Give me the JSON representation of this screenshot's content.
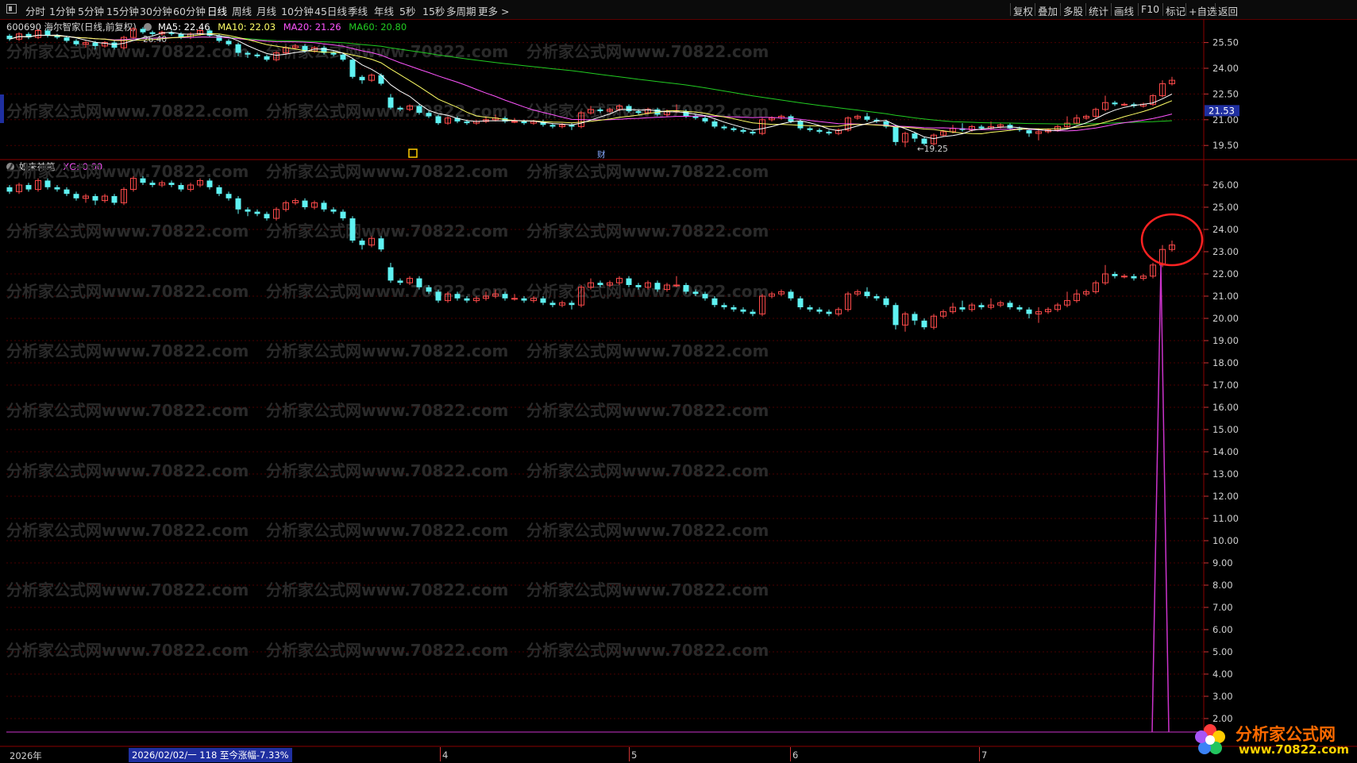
{
  "toolbar": {
    "periods": [
      "分时",
      "1分钟",
      "5分钟",
      "15分钟",
      "30分钟",
      "60分钟",
      "日线",
      "周线",
      "月线",
      "10分钟",
      "45日线",
      "季线",
      "年线",
      "5秒",
      "15秒",
      "多周期",
      "更多 >"
    ],
    "active_period": "日线",
    "tools": [
      "复权",
      "叠加",
      "多股",
      "统计",
      "画线",
      "F10",
      "标记",
      "+自选",
      "返回"
    ]
  },
  "main_info": {
    "title": "600690 海尔智家(日线,前复权)",
    "ma5": "MA5: 22.46",
    "ma10": "MA10: 22.03",
    "ma20": "MA20: 21.26",
    "ma60": "MA60: 20.80",
    "colors": {
      "ma5": "#ffffff",
      "ma10": "#ffff66",
      "ma20": "#ff55ff",
      "ma60": "#22cc22"
    }
  },
  "indicator_info": {
    "name": "如来神笔",
    "value": "XG: 0.00"
  },
  "price_axis_main": [
    "25.50",
    "24.00",
    "22.50",
    "21.00",
    "19.50"
  ],
  "current_price_tag": "21.53",
  "price_axis_sub": [
    "26.00",
    "25.00",
    "24.00",
    "23.00",
    "22.00",
    "21.00",
    "20.00",
    "19.00",
    "18.00",
    "17.00",
    "16.00",
    "15.00",
    "14.00",
    "13.00",
    "12.00",
    "11.00",
    "10.00",
    "9.00",
    "8.00",
    "7.00",
    "6.00",
    "5.00",
    "4.00",
    "3.00",
    "2.00"
  ],
  "annotations": {
    "high_label": "26.40",
    "low_label": "←19.25",
    "event_marker_1": "回",
    "event_marker_2": "财"
  },
  "watermark": "分析家公式网www.70822.com",
  "x_axis": {
    "year": "2026年",
    "cursor_info": "2026/02/02/一 118 至今涨幅-7.33%",
    "months": [
      "4",
      "5",
      "6",
      "7"
    ]
  },
  "logo": {
    "cn": "分析家公式网",
    "url": "www.70822.com"
  },
  "chart_data": {
    "type": "candlestick",
    "up_color": "#ff4a4a",
    "down_color": "#5ff2f2",
    "x_axis_note": "daily bars, 2026",
    "candles": [
      [
        25.9,
        25.7,
        26.0,
        25.6
      ],
      [
        25.7,
        26.0,
        26.1,
        25.6
      ],
      [
        26.0,
        25.8,
        26.1,
        25.7
      ],
      [
        25.8,
        26.2,
        26.3,
        25.7
      ],
      [
        26.2,
        25.9,
        26.3,
        25.8
      ],
      [
        25.9,
        25.8,
        26.0,
        25.7
      ],
      [
        25.8,
        25.6,
        25.9,
        25.5
      ],
      [
        25.6,
        25.4,
        25.7,
        25.3
      ],
      [
        25.4,
        25.5,
        25.6,
        25.2
      ],
      [
        25.5,
        25.3,
        25.6,
        25.1
      ],
      [
        25.3,
        25.5,
        25.6,
        25.2
      ],
      [
        25.5,
        25.2,
        25.6,
        25.1
      ],
      [
        25.2,
        25.8,
        25.9,
        25.1
      ],
      [
        25.8,
        26.3,
        26.4,
        25.7
      ],
      [
        26.3,
        26.1,
        26.4,
        26.0
      ],
      [
        26.1,
        26.0,
        26.2,
        25.9
      ],
      [
        26.0,
        26.1,
        26.2,
        25.9
      ],
      [
        26.1,
        26.0,
        26.2,
        25.9
      ],
      [
        26.0,
        25.8,
        26.1,
        25.7
      ],
      [
        25.8,
        26.0,
        26.1,
        25.7
      ],
      [
        26.0,
        26.2,
        26.3,
        25.9
      ],
      [
        26.2,
        25.9,
        26.3,
        25.8
      ],
      [
        25.9,
        25.6,
        26.0,
        25.5
      ],
      [
        25.6,
        25.4,
        25.7,
        25.3
      ],
      [
        25.4,
        24.9,
        25.5,
        24.7
      ],
      [
        24.9,
        24.8,
        25.0,
        24.6
      ],
      [
        24.8,
        24.7,
        24.9,
        24.6
      ],
      [
        24.7,
        24.5,
        24.8,
        24.4
      ],
      [
        24.5,
        24.9,
        25.0,
        24.4
      ],
      [
        24.9,
        25.2,
        25.3,
        24.8
      ],
      [
        25.2,
        25.3,
        25.4,
        25.1
      ],
      [
        25.3,
        25.0,
        25.4,
        24.9
      ],
      [
        25.0,
        25.2,
        25.3,
        24.9
      ],
      [
        25.2,
        24.9,
        25.3,
        24.8
      ],
      [
        24.9,
        24.8,
        25.0,
        24.7
      ],
      [
        24.8,
        24.5,
        24.9,
        24.4
      ],
      [
        24.5,
        23.5,
        24.6,
        23.4
      ],
      [
        23.5,
        23.3,
        23.6,
        23.1
      ],
      [
        23.3,
        23.6,
        23.7,
        23.2
      ],
      [
        23.6,
        23.1,
        23.7,
        23.0
      ],
      [
        22.3,
        21.7,
        22.5,
        21.6
      ],
      [
        21.7,
        21.6,
        21.8,
        21.5
      ],
      [
        21.6,
        21.8,
        21.9,
        21.5
      ],
      [
        21.8,
        21.4,
        21.9,
        21.3
      ],
      [
        21.4,
        21.2,
        21.5,
        21.1
      ],
      [
        21.2,
        20.8,
        21.3,
        20.7
      ],
      [
        20.8,
        21.1,
        21.2,
        20.7
      ],
      [
        21.1,
        20.9,
        21.2,
        20.8
      ],
      [
        20.9,
        20.8,
        21.0,
        20.7
      ],
      [
        20.8,
        20.9,
        21.0,
        20.7
      ],
      [
        20.9,
        21.0,
        21.2,
        20.8
      ],
      [
        21.0,
        21.1,
        21.3,
        20.9
      ],
      [
        21.1,
        20.9,
        21.2,
        20.8
      ],
      [
        20.9,
        20.9,
        21.1,
        20.8
      ],
      [
        20.9,
        20.8,
        21.0,
        20.7
      ],
      [
        20.8,
        20.9,
        21.0,
        20.7
      ],
      [
        20.9,
        20.7,
        21.0,
        20.6
      ],
      [
        20.7,
        20.6,
        20.8,
        20.5
      ],
      [
        20.6,
        20.7,
        20.8,
        20.5
      ],
      [
        20.7,
        20.6,
        20.8,
        20.4
      ],
      [
        20.6,
        21.4,
        21.5,
        20.5
      ],
      [
        21.4,
        21.6,
        21.8,
        21.3
      ],
      [
        21.6,
        21.5,
        21.7,
        21.4
      ],
      [
        21.5,
        21.6,
        21.7,
        21.4
      ],
      [
        21.6,
        21.8,
        21.9,
        21.5
      ],
      [
        21.8,
        21.5,
        21.9,
        21.4
      ],
      [
        21.5,
        21.4,
        21.6,
        21.3
      ],
      [
        21.4,
        21.6,
        21.7,
        21.3
      ],
      [
        21.6,
        21.3,
        21.7,
        21.2
      ],
      [
        21.3,
        21.5,
        21.6,
        21.2
      ],
      [
        21.5,
        21.5,
        21.9,
        21.4
      ],
      [
        21.5,
        21.2,
        21.6,
        21.1
      ],
      [
        21.2,
        21.1,
        21.3,
        21.0
      ],
      [
        21.1,
        20.9,
        21.2,
        20.8
      ],
      [
        20.9,
        20.6,
        21.0,
        20.5
      ],
      [
        20.6,
        20.5,
        20.7,
        20.4
      ],
      [
        20.5,
        20.4,
        20.6,
        20.3
      ],
      [
        20.4,
        20.3,
        20.5,
        20.2
      ],
      [
        20.3,
        20.2,
        20.4,
        20.1
      ],
      [
        20.2,
        21.0,
        21.1,
        20.1
      ],
      [
        21.0,
        21.1,
        21.2,
        20.9
      ],
      [
        21.1,
        21.2,
        21.3,
        21.0
      ],
      [
        21.2,
        20.9,
        21.3,
        20.8
      ],
      [
        20.9,
        20.5,
        21.0,
        20.4
      ],
      [
        20.5,
        20.4,
        20.6,
        20.3
      ],
      [
        20.4,
        20.3,
        20.5,
        20.2
      ],
      [
        20.3,
        20.2,
        20.4,
        20.1
      ],
      [
        20.2,
        20.4,
        20.5,
        20.1
      ],
      [
        20.4,
        21.1,
        21.2,
        20.3
      ],
      [
        21.1,
        21.2,
        21.3,
        21.0
      ],
      [
        21.2,
        21.0,
        21.4,
        20.9
      ],
      [
        21.0,
        20.9,
        21.1,
        20.8
      ],
      [
        20.9,
        20.6,
        21.0,
        20.5
      ],
      [
        20.6,
        19.7,
        20.7,
        19.5
      ],
      [
        19.7,
        20.2,
        20.3,
        19.4
      ],
      [
        20.2,
        19.9,
        20.3,
        19.7
      ],
      [
        19.9,
        19.6,
        20.0,
        19.5
      ],
      [
        19.6,
        20.1,
        20.2,
        19.5
      ],
      [
        20.1,
        20.3,
        20.4,
        20.0
      ],
      [
        20.3,
        20.5,
        20.7,
        20.2
      ],
      [
        20.5,
        20.4,
        20.8,
        20.3
      ],
      [
        20.4,
        20.6,
        20.7,
        20.3
      ],
      [
        20.6,
        20.5,
        20.7,
        20.4
      ],
      [
        20.5,
        20.6,
        20.9,
        20.4
      ],
      [
        20.6,
        20.7,
        20.8,
        20.5
      ],
      [
        20.7,
        20.5,
        20.8,
        20.4
      ],
      [
        20.5,
        20.4,
        20.6,
        20.3
      ],
      [
        20.4,
        20.2,
        20.5,
        20.0
      ],
      [
        20.2,
        20.3,
        20.5,
        19.8
      ],
      [
        20.3,
        20.4,
        20.5,
        20.2
      ],
      [
        20.4,
        20.6,
        20.7,
        20.3
      ],
      [
        20.6,
        20.8,
        21.2,
        20.5
      ],
      [
        20.8,
        21.1,
        21.3,
        20.7
      ],
      [
        21.1,
        21.2,
        21.3,
        21.0
      ],
      [
        21.2,
        21.6,
        21.7,
        21.1
      ],
      [
        21.6,
        22.0,
        22.4,
        21.5
      ],
      [
        22.0,
        21.9,
        22.1,
        21.8
      ],
      [
        21.9,
        21.9,
        22.0,
        21.8
      ],
      [
        21.9,
        21.8,
        22.0,
        21.7
      ],
      [
        21.8,
        21.9,
        22.0,
        21.7
      ],
      [
        21.9,
        22.4,
        22.5,
        21.8
      ],
      [
        22.4,
        23.1,
        23.3,
        22.3
      ],
      [
        23.1,
        23.3,
        23.5,
        23.0
      ]
    ],
    "indicator_spike": {
      "series": "XG",
      "value": 0.0,
      "note": "purple spike at last bars"
    },
    "ylim_main": [
      19.0,
      26.5
    ],
    "ylim_sub": [
      1.5,
      26.5
    ]
  }
}
